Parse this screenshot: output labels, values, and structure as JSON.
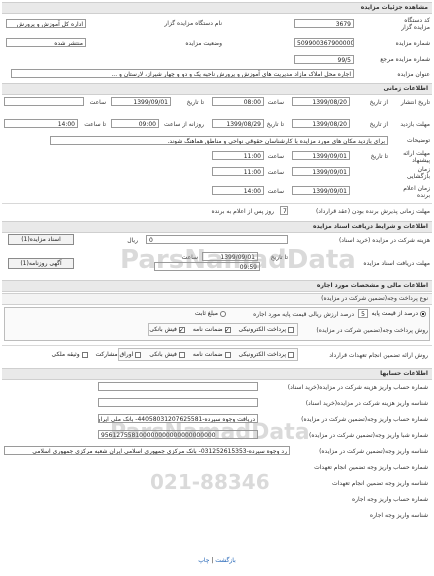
{
  "header": {
    "title": "مشاهده جزئیات مزایده"
  },
  "general": {
    "device_code_label": "کد دستگاه مزایده گزار",
    "device_code": "3679",
    "device_name_label": "نام دستگاه مزایده گزار",
    "device_name": "اداره کل آموزش و پرورش",
    "auction_number_label": "شماره مزایده",
    "auction_number": "5099003679000005",
    "status_label": "وضعیت مزایده",
    "status": "منتشر شده",
    "ref_number_label": "شماره مزایده مرجع",
    "ref_number": "99/5",
    "title_label": "عنوان مزایده",
    "title": "اجاره محل  املاک  مازاد مدیریت های آموزش و پرورش ناحیه یک و دو و چهار شیراز، لارستان و ..."
  },
  "timing": {
    "header": "اطلاعات زمانی",
    "publish": {
      "label": "تاریخ انتشار",
      "from_date": "1399/08/20",
      "from_time": "08:00",
      "to_date": "1399/09/01",
      "to_time": ""
    },
    "visit": {
      "label": "مهلت بازدید",
      "from_date": "1399/08/20",
      "from_time": "09:00",
      "to_date": "1399/08/29",
      "to_time": "14:00"
    },
    "from_label": "از تاریخ",
    "to_label": "تا تاریخ",
    "time_label": "ساعت",
    "to_time_label": "تا ساعت",
    "working_days_label": "روزانه از ساعت",
    "desc_label": "توضیحات",
    "desc": "برای بازدید مکان های مورد مزایده با کارشناسان حقوقی نواحی و مناطق هماهنگ شوند.",
    "offer_deadline_label": "مهلت ارائه پیشنهاد",
    "offer_deadline_date": "1399/09/01",
    "offer_deadline_time": "11:00",
    "opening_time_label": "زمان بازگشایی",
    "opening_date": "1399/09/01",
    "announce_label": "زمان اعلام برنده",
    "announce_time": "14:00",
    "announce_date": "1399/09/01"
  },
  "contract": {
    "deadline_label": "مهلت زمانی پذیرش برنده بودن (عقد قرارداد)",
    "days": "7",
    "days_suffix": "روز پس از اعلام به برنده"
  },
  "auction_docs": {
    "header": "اطلاعات و شرایط دریافت اسناد مزایده",
    "fee_label": "هزینه شرکت در مزایده (خرید اسناد)",
    "fee": "0",
    "currency": "ریال",
    "docs_button": "اسناد مزایده(1)",
    "deadline_label": "مهلت دریافت اسناد مزایده",
    "deadline_date": "1399/09/01",
    "deadline_time": "09:59",
    "ad_button": "آگهی روزنامه(1)"
  },
  "financial": {
    "header": "اطلاعات مالی و مشخصات مورد اجاره",
    "guarantee_header": "نوع پرداخت وجه(تضمین شرکت در مزایده)",
    "percent_label": "درصد ارزش ریالی قیمت پایه مورد اجاره",
    "percent": "5",
    "percent_prefix": "درصد از قیمت پایه",
    "fixed_label": "مبلغ ثابت",
    "methods_label": "روش پرداخت وجه(تضمین شرکت در مزایده)",
    "method_electronic": "پرداخت الکترونیکی",
    "method_guarantee": "ضمانت نامه",
    "method_check": "فیش بانکی",
    "contract_guarantee_label": "روش ارائه تضمین انجام تعهدات قرارداد",
    "cg_electronic": "پرداخت الکترونیکی",
    "cg_guarantee": "ضمانت نامه",
    "cg_check": "فیش بانکی",
    "cg_bonds": "اوراق مشارکت",
    "cg_property": "وثیقه ملکی"
  },
  "accounts": {
    "header": "اطلاعات حسابها",
    "fee_account_label": "شماره حساب واریز هزینه شرکت در مزایده(خرید اسناد)",
    "fee_account": "",
    "fee_owner_label": "شناسه واریز هزینه شرکت در مزایده(خرید اسناد)",
    "fee_owner": "",
    "guarantee_account_label": "شماره حساب واریز وجه(تضمین شرکت در مزایده)",
    "guarantee_account": "دریافت وجوه سپرده-44058031207625581- بانک ملی ایران شعبه JDV 7",
    "guarantee_id_label": "شماره شبا واریز وجه(تضمین شرکت در مزایده)",
    "guarantee_id": "956127558100000000000000000000",
    "guarantee_sheba_label": "شناسه واریز وجه(تضمین شرکت در مزایده)",
    "guarantee_sheba": "رد وجوه سپرده-031252615353- بانک مرکزی جمهوری اسلامی ایران شعبه مرکزی جمهوری اسلامی",
    "commit_account_label": "شماره حساب واریز وجه تضمین انجام تعهدات",
    "commit_account": "",
    "commit_id_label": "شناسه واریز وجه تضمین انجام تعهدات",
    "commit_id": "",
    "rent_account_label": "شماره حساب واریز وجه اجاره",
    "rent_account": "",
    "rent_id_label": "شناسه واریز وجه اجاره",
    "rent_id": ""
  },
  "footer": {
    "back": "بازگشت",
    "print": "چاپ",
    "sep": "|"
  },
  "watermark": {
    "text1": "ParsNamadData",
    "text2": "ParsNamadData",
    "text3": "021-88346"
  }
}
